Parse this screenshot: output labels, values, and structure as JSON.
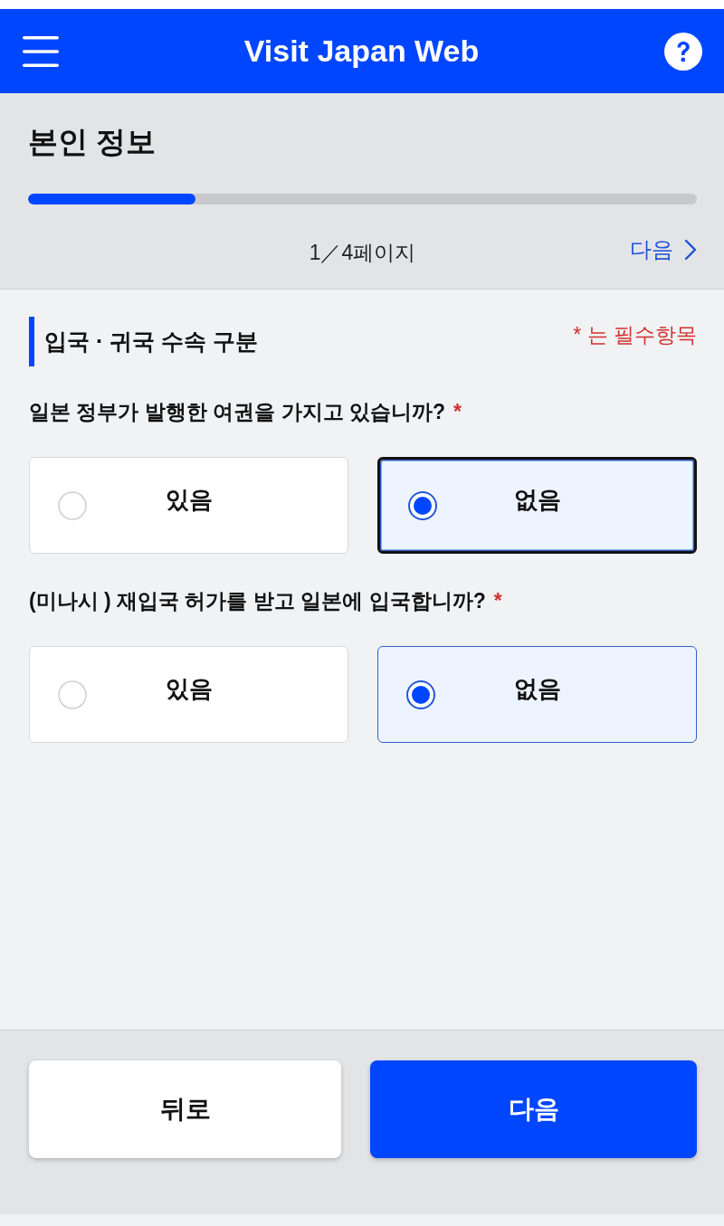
{
  "header": {
    "title": "Visit Japan Web"
  },
  "progress": {
    "title": "본인 정보",
    "level": 0.25,
    "page_label": "1／4페이지",
    "next_link": "다음"
  },
  "section": {
    "heading": "입국 · 귀국 수속 구분",
    "required_note": "* 는 필수항목"
  },
  "questions": [
    {
      "text": "일본 정부가 발행한 여권을 가지고 있습니까?",
      "required_mark": "*",
      "options": [
        {
          "label": "있음",
          "selected": false,
          "focused": false
        },
        {
          "label": "없음",
          "selected": true,
          "focused": true
        }
      ]
    },
    {
      "text": "(미나시 ) 재입국 허가를 받고 일본에 입국합니까?",
      "required_mark": "*",
      "options": [
        {
          "label": "있음",
          "selected": false,
          "focused": false
        },
        {
          "label": "없음",
          "selected": true,
          "focused": false
        }
      ]
    }
  ],
  "footer": {
    "buttons": [
      {
        "label": "뒤로",
        "kind": "secondary"
      },
      {
        "label": "다음",
        "kind": "primary"
      }
    ]
  }
}
